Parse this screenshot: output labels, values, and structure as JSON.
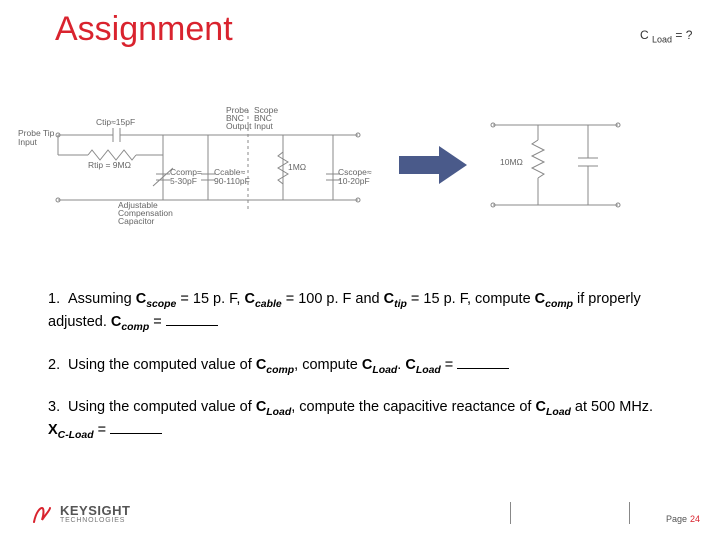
{
  "title": "Assignment",
  "diagram_left": {
    "probe_tip_label": "Probe Tip\nInput",
    "ctip_label": "Ctip≈15pF",
    "rtip_label": "Rtip = 9MΩ",
    "adj_cap_label": "Adjustable\nCompensation\nCapacitor",
    "ccomp_label": "Ccomp=\n5-30pF",
    "ccable_label": "Ccable≈\n90-110pF",
    "rscope_label": "1MΩ",
    "probe_bnc_label": "Probe\nBNC\nOutput",
    "scope_bnc_label": "Scope\nBNC\nInput",
    "cscope_label": "Cscope≈\n10-20pF"
  },
  "diagram_right": {
    "r_label": "10MΩ"
  },
  "c_load_eq": {
    "prefix": "C ",
    "sub": "Load",
    "suffix": " = ?"
  },
  "questions": {
    "q1": {
      "num": "1.",
      "parts": [
        "Assuming ",
        {
          "b": "C"
        },
        {
          "sub": "scope"
        },
        " = 15 p. F, ",
        {
          "b": "C"
        },
        {
          "sub": "cable"
        },
        " = 100 p. F and ",
        {
          "b": "C"
        },
        {
          "sub": "tip"
        },
        " = 15 p. F, compute ",
        {
          "b": "C"
        },
        {
          "sub": "comp"
        },
        " if properly adjusted.    ",
        {
          "b": "C"
        },
        {
          "sub": "comp"
        },
        " = ",
        {
          "blank": true
        }
      ]
    },
    "q2": {
      "num": "2.",
      "parts": [
        "Using the computed value of ",
        {
          "b": "C"
        },
        {
          "sub": "comp"
        },
        ", compute ",
        {
          "b": "C"
        },
        {
          "sub": "Load"
        },
        ".    ",
        {
          "b": "C"
        },
        {
          "sub": "Load"
        },
        " = ",
        {
          "blank": true
        }
      ]
    },
    "q3": {
      "num": "3.",
      "parts": [
        "Using the computed value of ",
        {
          "b": "C"
        },
        {
          "sub": "Load"
        },
        ", compute the capacitive reactance of ",
        {
          "b": "C"
        },
        {
          "sub": "Load"
        },
        " at 500 MHz.    ",
        {
          "b": "X"
        },
        {
          "sub": "C-Load"
        },
        " = ",
        {
          "blank": true
        }
      ]
    }
  },
  "logo": {
    "name": "KEYSIGHT",
    "sub": "TECHNOLOGIES"
  },
  "page": {
    "label": "Page",
    "num": "24"
  }
}
